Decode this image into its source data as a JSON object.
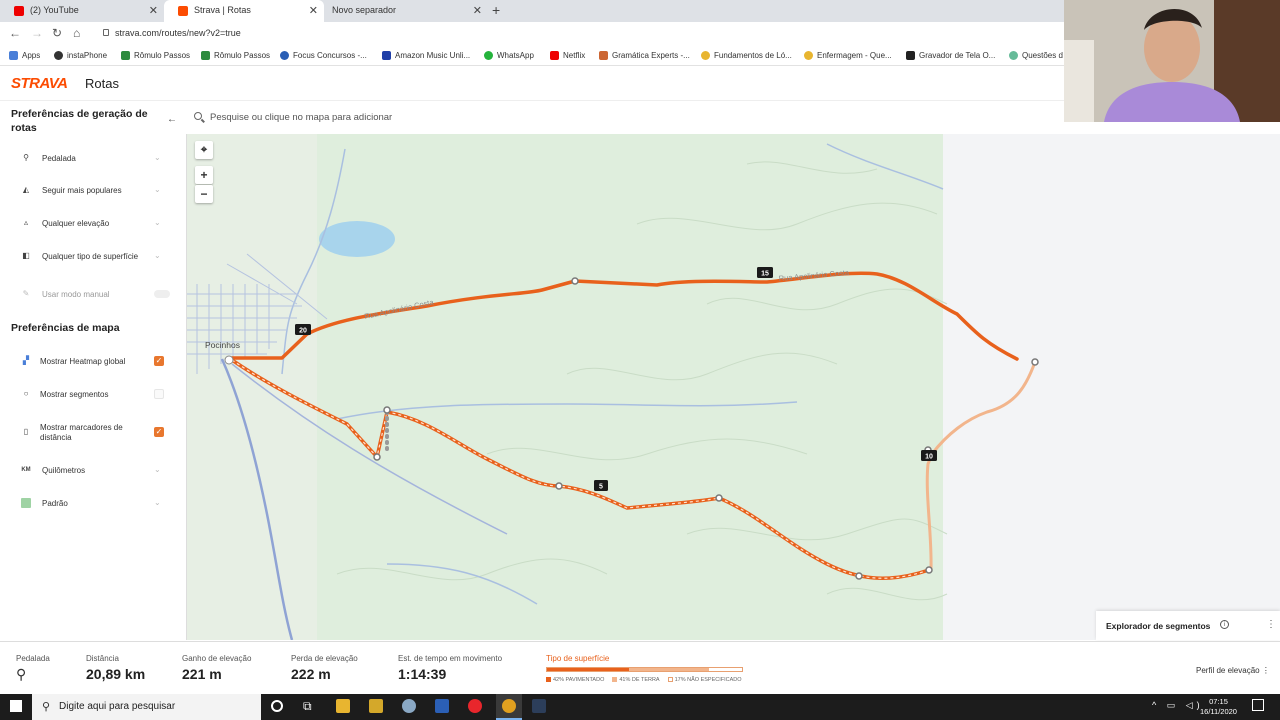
{
  "browser": {
    "tabs": [
      {
        "title": "(2) YouTube",
        "active": false
      },
      {
        "title": "Strava | Rotas",
        "active": true
      },
      {
        "title": "Novo separador",
        "active": false
      }
    ],
    "url": "strava.com/routes/new?v2=true",
    "bookmarks": [
      "Apps",
      "instaPhone",
      "Rômulo Passos",
      "Rômulo Passos",
      "Focus Concursos -...",
      "Amazon Music Unli...",
      "WhatsApp",
      "Netflix",
      "Gramática Experts -...",
      "Fundamentos de Ló...",
      "Enfermagem - Que...",
      "Gravador de Tela O...",
      "Questões d"
    ]
  },
  "header": {
    "logo": "STRAVA",
    "title": "Rotas"
  },
  "sidebar": {
    "route_prefs_title": "Preferências de geração de rotas",
    "route_options": [
      {
        "label": "Pedalada",
        "icon": "bike-icon"
      },
      {
        "label": "Seguir mais populares",
        "icon": "popularity-icon"
      },
      {
        "label": "Qualquer elevação",
        "icon": "elevation-icon"
      },
      {
        "label": "Qualquer tipo de superfície",
        "icon": "surface-icon"
      }
    ],
    "manual_mode_label": "Usar modo manual",
    "map_prefs_title": "Preferências de mapa",
    "map_options": [
      {
        "label": "Mostrar Heatmap global",
        "checked": true
      },
      {
        "label": "Mostrar segmentos",
        "checked": false
      },
      {
        "label": "Mostrar marcadores de distância",
        "checked": true
      },
      {
        "label": "Quilômetros",
        "checked": null
      },
      {
        "label": "Padrão",
        "checked": null
      }
    ]
  },
  "search": {
    "placeholder": "Pesquise ou clique no mapa para adicionar"
  },
  "map": {
    "town_label": "Pocinhos",
    "road_label_1": "Rua Apolinário Costa",
    "road_label_2": "Rua Apolinário Costa",
    "distance_markers": [
      "20",
      "15",
      "10",
      "5"
    ],
    "route_color": "#e8611c",
    "zoom_in": "+",
    "zoom_out": "−"
  },
  "segment_explorer": {
    "label": "Explorador de segmentos"
  },
  "stats": {
    "activity_label": "Pedalada",
    "distance": {
      "label": "Distância",
      "value": "20,89 km"
    },
    "elev_gain": {
      "label": "Ganho de elevação",
      "value": "221 m"
    },
    "elev_loss": {
      "label": "Perda de elevação",
      "value": "222 m"
    },
    "moving_time": {
      "label": "Est. de tempo em movimento",
      "value": "1:14:39"
    },
    "surface": {
      "label": "Tipo de superfície",
      "paved": {
        "label": "42% PAVIMENTADO",
        "fraction": 0.42,
        "color": "#e8611c"
      },
      "dirt": {
        "label": "41% DE TERRA",
        "fraction": 0.41,
        "color": "#f2b58c"
      },
      "unknown": {
        "label": "17% NÃO ESPECIFICADO",
        "fraction": 0.17,
        "color": "#ffffff"
      }
    },
    "elevation_profile_label": "Perfil de elevação"
  },
  "taskbar": {
    "search_placeholder": "Digite aqui para pesquisar",
    "time": "07:15",
    "date": "16/11/2020"
  }
}
